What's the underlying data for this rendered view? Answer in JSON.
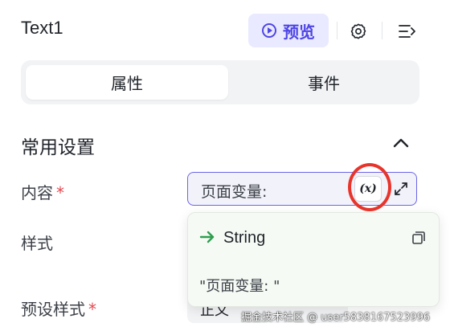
{
  "header": {
    "title": "Text1",
    "preview_label": "预览"
  },
  "tabs": [
    {
      "label": "属性",
      "active": true
    },
    {
      "label": "事件",
      "active": false
    }
  ],
  "section": {
    "title": "常用设置"
  },
  "fields": {
    "content_label": "内容",
    "content_required": "*",
    "content_value": "页面变量:",
    "var_button_label": "(x)",
    "style_label": "样式",
    "preset_label": "预设样式",
    "preset_required": "*",
    "preset_value": "正文"
  },
  "popover": {
    "type_label": "String",
    "value": "\"页面变量: \""
  },
  "watermark": "掘金技术社区 @ user5838167523996",
  "colors": {
    "accent": "#4f46e5",
    "accent_bg": "#e9eaff",
    "required": "#e5484d",
    "annotation_circle": "#e8352b",
    "type_arrow": "#2e9e4f"
  },
  "icons": [
    "play-icon",
    "gear-icon",
    "menu-collapse-icon",
    "chevron-up-icon",
    "expand-icon",
    "arrow-right-icon",
    "copy-icon"
  ]
}
